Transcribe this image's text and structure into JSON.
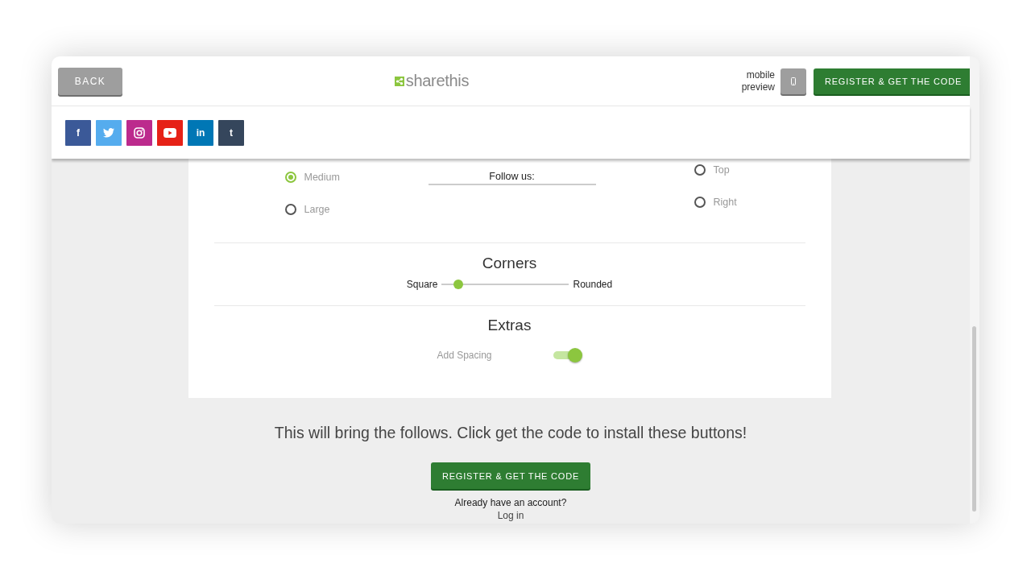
{
  "header": {
    "back_button": "BACK",
    "logo": "sharethis",
    "mobile_preview_label": "mobile preview",
    "register_button": "REGISTER & GET THE CODE"
  },
  "social_buttons": [
    {
      "kind": "letter",
      "label": "f",
      "color": "#3b5998"
    },
    {
      "kind": "twitter",
      "color": "#55acee"
    },
    {
      "kind": "instagram",
      "color": "#bc2a8d"
    },
    {
      "kind": "youtube",
      "color": "#e62117"
    },
    {
      "kind": "letter",
      "label": "in",
      "color": "#0077b5"
    },
    {
      "kind": "letter",
      "label": "t",
      "color": "#35465c"
    }
  ],
  "size_options": [
    {
      "label": "Medium",
      "selected": true
    },
    {
      "label": "Large",
      "selected": false
    }
  ],
  "preview_label": "Follow us:",
  "position_options": [
    {
      "label": "Top",
      "selected": false
    },
    {
      "label": "Right",
      "selected": false
    }
  ],
  "corners": {
    "title": "Corners",
    "min_label": "Square",
    "max_label": "Rounded",
    "level": 0.13
  },
  "extras": {
    "title": "Extras",
    "toggles": [
      {
        "label": "Add Spacing",
        "on": true
      }
    ]
  },
  "footer": {
    "message": "This will bring the follows. Click get the code to install these buttons!",
    "register_button": "REGISTER & GET THE CODE",
    "account_prompt": "Already have an account?",
    "login_link": "Log in"
  }
}
